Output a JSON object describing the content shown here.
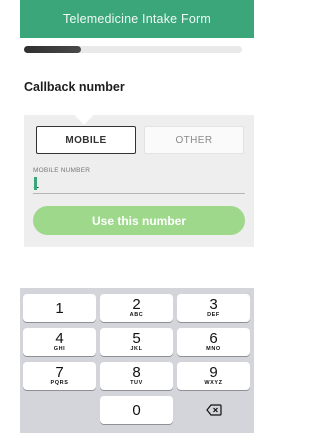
{
  "header": {
    "title": "Telemedicine Intake Form",
    "bg_color": "#3aa67a"
  },
  "progress": {
    "fraction": 0.26
  },
  "section": {
    "title": "Callback number"
  },
  "phone_type": {
    "options": [
      {
        "label": "MOBILE",
        "selected": true
      },
      {
        "label": "OTHER",
        "selected": false
      }
    ]
  },
  "mobile_field": {
    "label": "MOBILE NUMBER",
    "value": "1"
  },
  "primary_button": {
    "label": "Use this number",
    "color": "#9ed88a"
  },
  "keypad": {
    "keys": [
      {
        "digit": "1",
        "letters": ""
      },
      {
        "digit": "2",
        "letters": "ABC"
      },
      {
        "digit": "3",
        "letters": "DEF"
      },
      {
        "digit": "4",
        "letters": "GHI"
      },
      {
        "digit": "5",
        "letters": "JKL"
      },
      {
        "digit": "6",
        "letters": "MNO"
      },
      {
        "digit": "7",
        "letters": "PQRS"
      },
      {
        "digit": "8",
        "letters": "TUV"
      },
      {
        "digit": "9",
        "letters": "WXYZ"
      },
      {
        "digit": "0",
        "letters": ""
      }
    ],
    "backspace_icon": "backspace-icon"
  }
}
